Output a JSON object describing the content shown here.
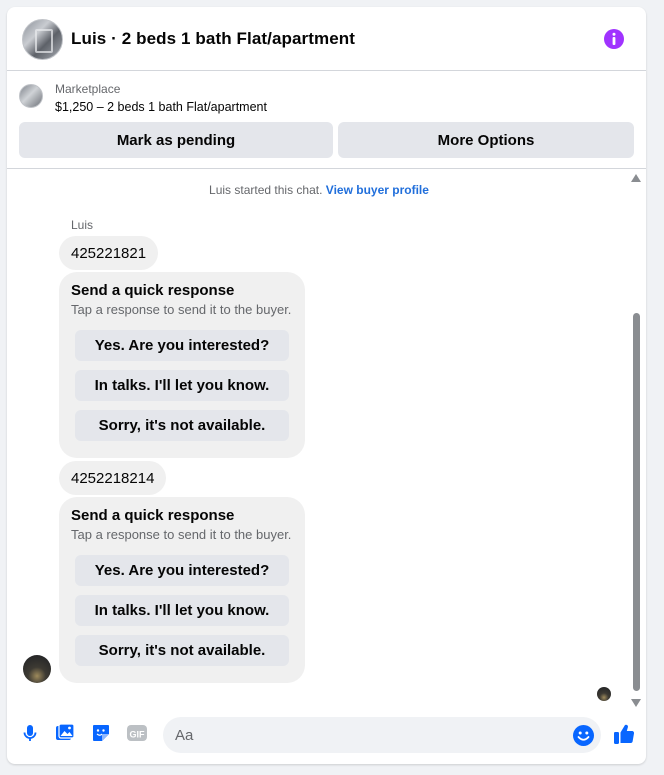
{
  "header": {
    "title": "Luis · 2 beds 1 bath Flat/apartment",
    "avatar": "listing-avatar",
    "info_icon": "info-icon"
  },
  "listing": {
    "label": "Marketplace",
    "title": "$1,250 – 2 beds 1 bath Flat/apartment"
  },
  "actions": {
    "pending_label": "Mark as pending",
    "more_label": "More Options"
  },
  "chat": {
    "started_text": "Luis started this chat.",
    "buyer_profile_link": "View buyer profile",
    "sender_name": "Luis",
    "messages": [
      {
        "phone": "425221821",
        "quick_response": {
          "title": "Send a quick response",
          "subtitle": "Tap a response to send it to the buyer.",
          "options": [
            "Yes. Are you interested?",
            "In talks. I'll let you know.",
            "Sorry, it's not available."
          ]
        }
      },
      {
        "phone": "4252218214",
        "quick_response": {
          "title": "Send a quick response",
          "subtitle": "Tap a response to send it to the buyer.",
          "options": [
            "Yes. Are you interested?",
            "In talks. I'll let you know.",
            "Sorry, it's not available."
          ]
        }
      }
    ]
  },
  "composer": {
    "placeholder": "Aa",
    "icons": [
      "microphone-icon",
      "photo-icon",
      "sticker-icon",
      "gif-icon",
      "emoji-icon",
      "thumbs-up-icon"
    ],
    "gif_label": "GIF"
  },
  "colors": {
    "accent": "#0866ff",
    "info": "#a033ff",
    "bubble": "#f0f0f0",
    "button": "#e4e6eb",
    "link": "#216fdb"
  }
}
